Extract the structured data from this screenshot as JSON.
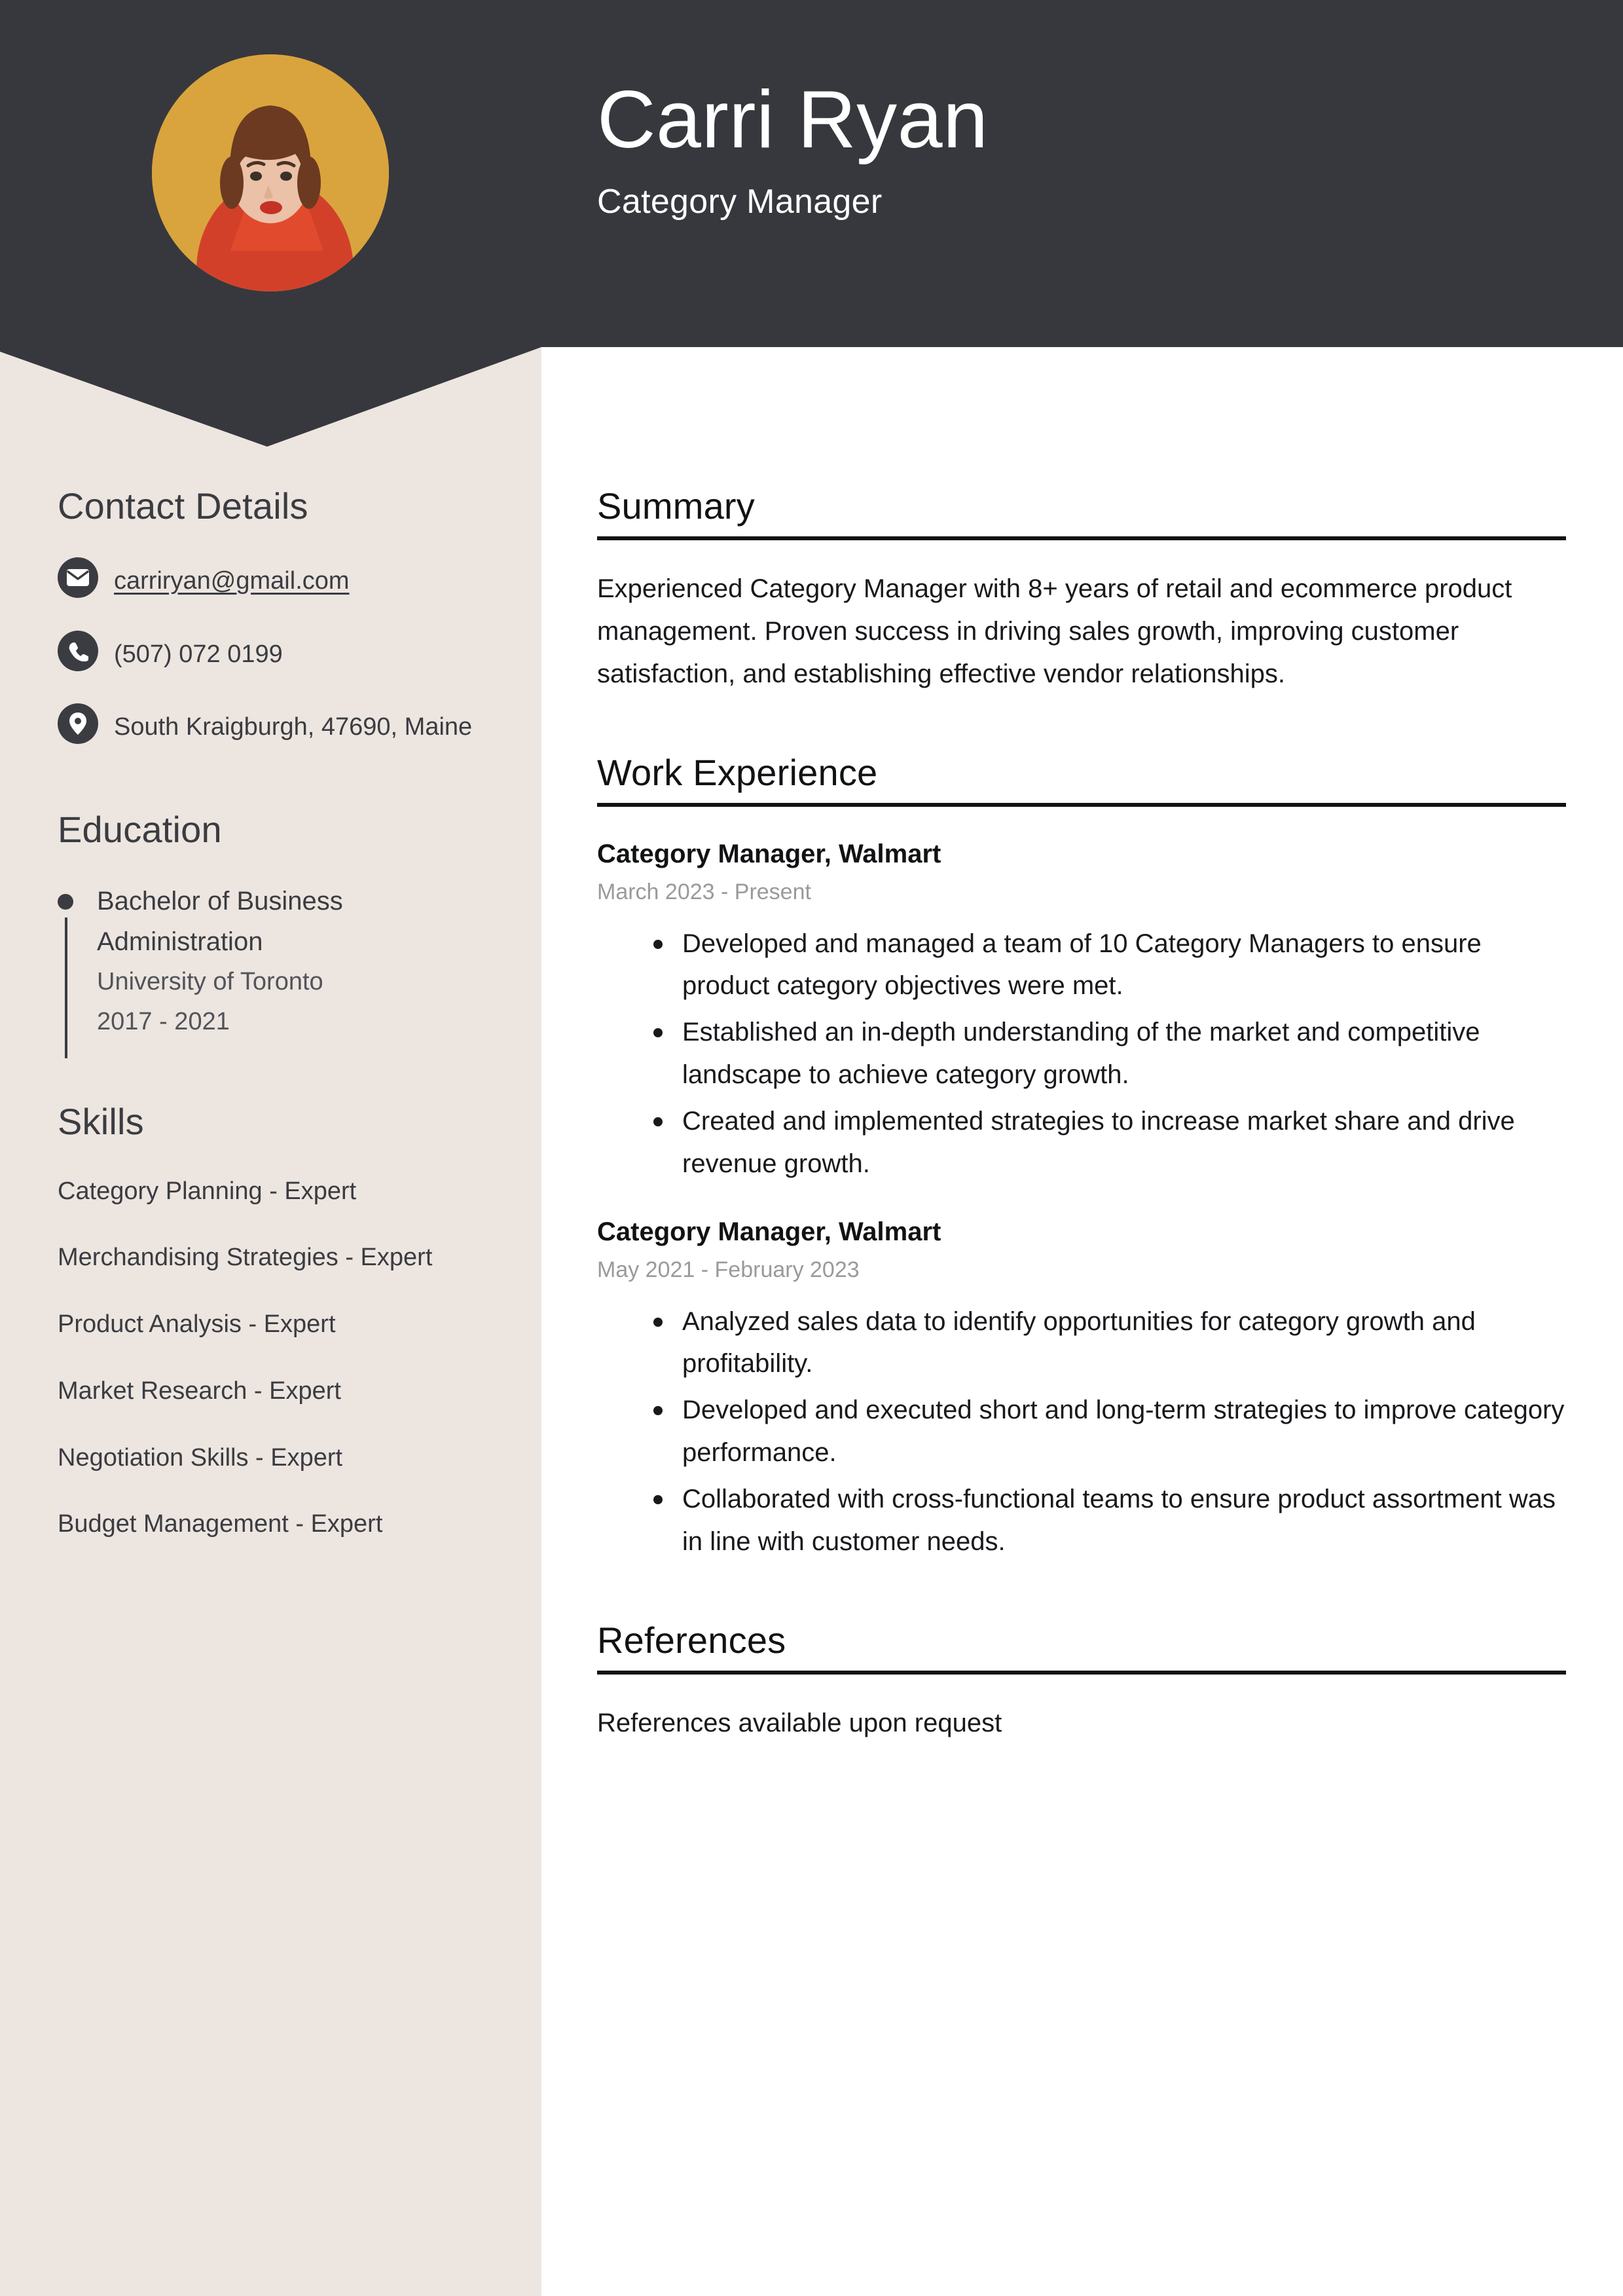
{
  "header": {
    "name": "Carri Ryan",
    "role": "Category Manager",
    "avatar_icon": "profile-photo",
    "bg_color": "#36383D",
    "avatar_bg_color": "#D9A43D"
  },
  "sidebar": {
    "bg_color": "#EDE5E0",
    "contact": {
      "heading": "Contact Details",
      "items": [
        {
          "icon": "envelope-icon",
          "value": "carriryan@gmail.com",
          "is_link": true
        },
        {
          "icon": "phone-icon",
          "value": "(507) 072 0199",
          "is_link": false
        },
        {
          "icon": "map-pin-icon",
          "value": "South Kraigburgh, 47690, Maine",
          "is_link": false
        }
      ]
    },
    "education": {
      "heading": "Education",
      "items": [
        {
          "degree": "Bachelor of Business Administration",
          "school": "University of Toronto",
          "dates": "2017 - 2021"
        }
      ]
    },
    "skills": {
      "heading": "Skills",
      "items": [
        "Category Planning - Expert",
        "Merchandising Strategies - Expert",
        "Product Analysis - Expert",
        "Market Research - Expert",
        "Negotiation Skills - Expert",
        "Budget Management - Expert"
      ]
    }
  },
  "main": {
    "summary": {
      "heading": "Summary",
      "text": "Experienced Category Manager with 8+ years of retail and ecommerce product management. Proven success in driving sales growth, improving customer satisfaction, and establishing effective vendor relationships."
    },
    "work_experience": {
      "heading": "Work Experience",
      "jobs": [
        {
          "title": "Category Manager, Walmart",
          "dates": "March 2023 - Present",
          "bullets": [
            "Developed and managed a team of 10 Category Managers to ensure product category objectives were met.",
            "Established an in-depth understanding of the market and competitive landscape to achieve category growth.",
            "Created and implemented strategies to increase market share and drive revenue growth."
          ]
        },
        {
          "title": "Category Manager, Walmart",
          "dates": "May 2021 - February 2023",
          "bullets": [
            "Analyzed sales data to identify opportunities for category growth and profitability.",
            "Developed and executed short and long-term strategies to improve category performance.",
            "Collaborated with cross-functional teams to ensure product assortment was in line with customer needs."
          ]
        }
      ]
    },
    "references": {
      "heading": "References",
      "text": "References available upon request"
    }
  }
}
